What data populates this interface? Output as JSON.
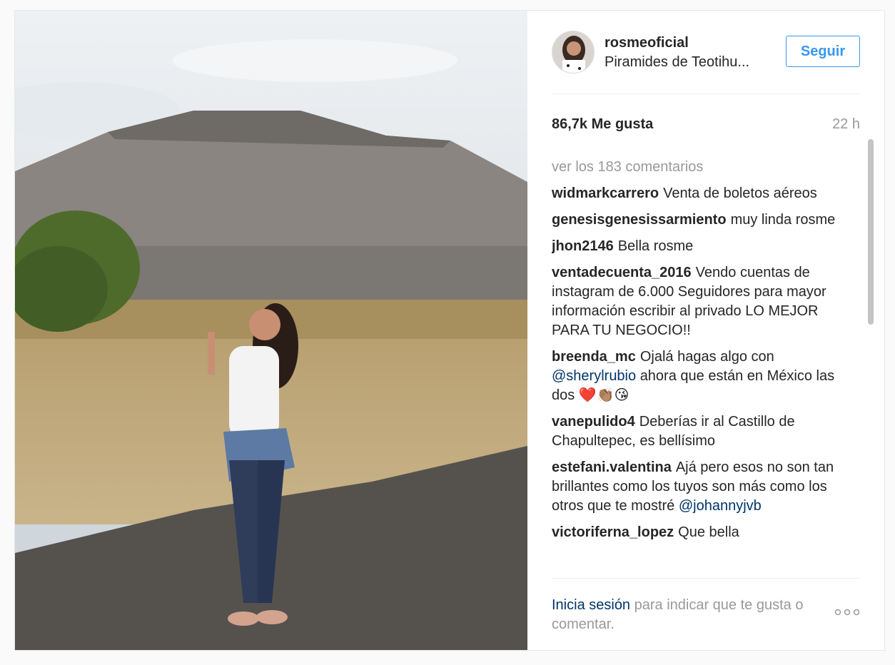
{
  "post": {
    "username": "rosmeoficial",
    "location": "Piramides de Teotihu...",
    "follow_label": "Seguir",
    "likes": "86,7k Me gusta",
    "time": "22 h",
    "view_all": "ver los 183 comentarios"
  },
  "comments": [
    {
      "user": "widmarkcarrero",
      "text": "Venta de boletos aéreos"
    },
    {
      "user": "genesisgenesissarmiento",
      "text": "muy linda rosme"
    },
    {
      "user": "jhon2146",
      "text": "Bella rosme"
    },
    {
      "user": "ventadecuenta_2016",
      "text": "Vendo cuentas de instagram de 6.000 Seguidores para mayor información escribir al privado LO MEJOR PARA TU NEGOCIO!!"
    },
    {
      "user": "breenda_mc",
      "text_before": "Ojalá hagas algo con",
      "mention": "@sherylrubio",
      "text_after": "ahora que están en México las dos ❤️👏🏽😘"
    },
    {
      "user": "vanepulido4",
      "text": "Deberías ir al Castillo de Chapultepec, es bellísimo"
    },
    {
      "user": "estefani.valentina",
      "text_before": "Ajá pero esos no son tan brillantes como los tuyos son más como los otros que te mostré",
      "mention": "@johannyjvb",
      "text_after": ""
    },
    {
      "user": "victoriferna_lopez",
      "text": "Que bella"
    }
  ],
  "footer": {
    "login_link": "Inicia sesión",
    "login_rest": "para indicar que te gusta o comentar."
  },
  "colors": {
    "accent": "#3897f0",
    "link": "#003569",
    "muted": "#999999"
  },
  "icons": {
    "more": "more-options-icon"
  }
}
